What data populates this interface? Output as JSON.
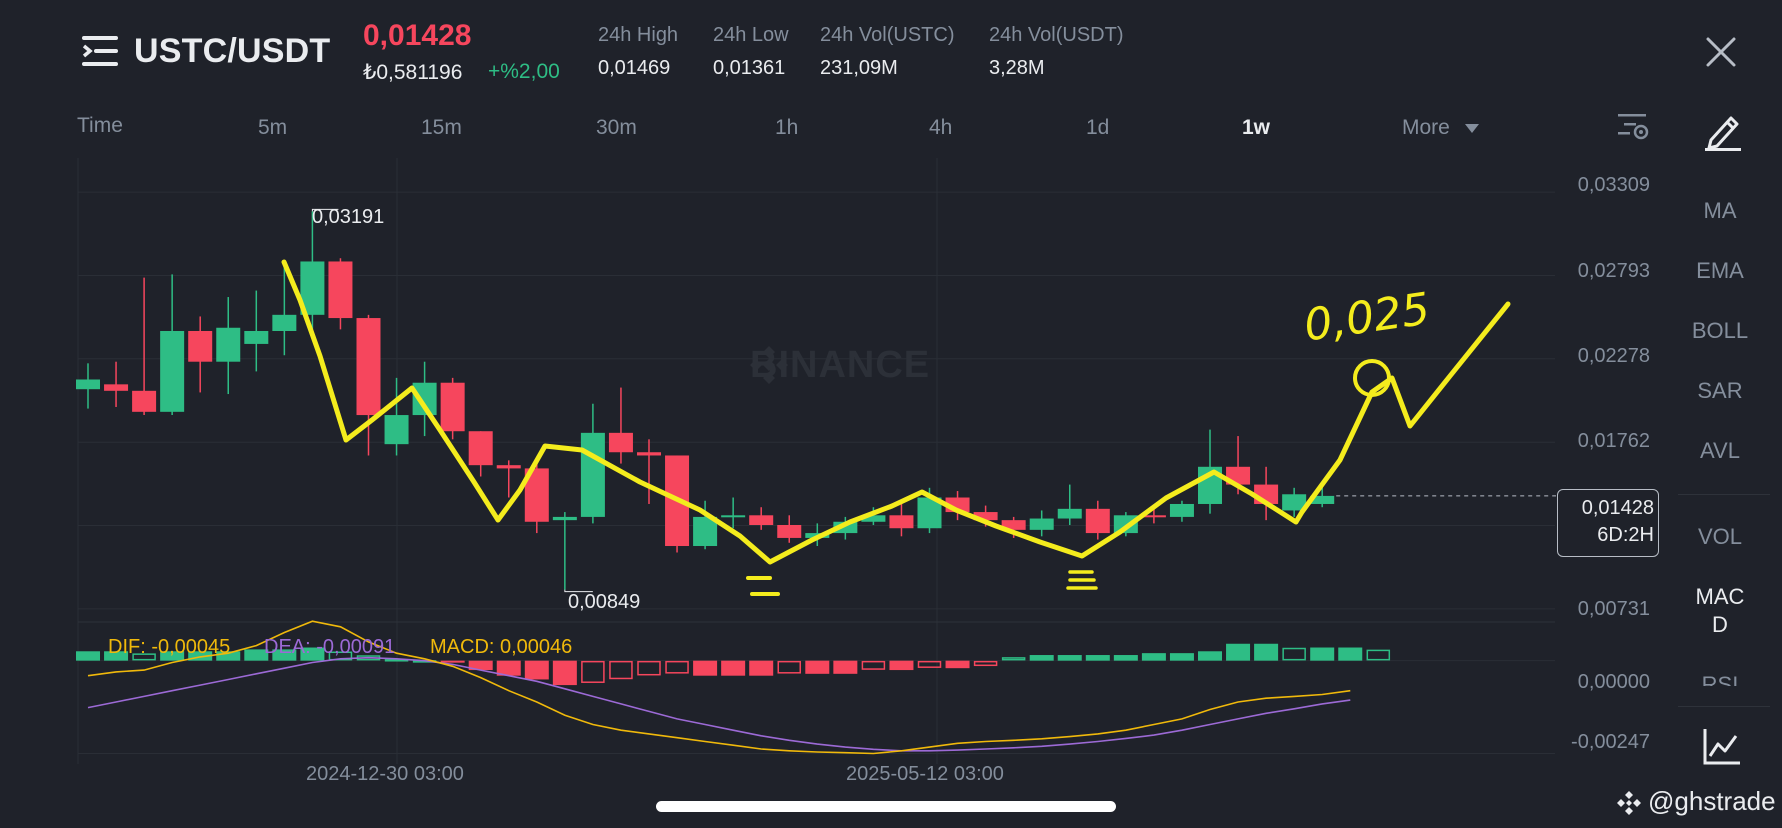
{
  "header": {
    "pair": "USTC/USDT",
    "last_price": "0,01428",
    "fiat_price": "₺0,581196",
    "change": "+%2,00",
    "stats": [
      {
        "label": "24h High",
        "value": "0,01469"
      },
      {
        "label": "24h Low",
        "value": "0,01361"
      },
      {
        "label": "24h Vol(USTC)",
        "value": "231,09M"
      },
      {
        "label": "24h Vol(USDT)",
        "value": "3,28M"
      }
    ]
  },
  "intervals": {
    "time": "Time",
    "m5": "5m",
    "m15": "15m",
    "m30": "30m",
    "h1": "1h",
    "h4": "4h",
    "d1": "1d",
    "w1": "1w",
    "more": "More",
    "active": "1w"
  },
  "indicators": {
    "ma": "MA",
    "ema": "EMA",
    "boll": "BOLL",
    "sar": "SAR",
    "avl": "AVL",
    "vol": "VOL",
    "macd": "MAC\nD",
    "rsi": "RSI"
  },
  "chart": {
    "watermark": "BINANCE",
    "price_ticks": [
      "0,03309",
      "0,02793",
      "0,02278",
      "0,01762",
      "0,00731"
    ],
    "macd_ticks": [
      "0,00000",
      "-0,00247"
    ],
    "time_ticks": [
      "2024-12-30 03:00",
      "2025-05-12 03:00"
    ],
    "current_price_tag": "0,01428",
    "candle_timer": "6D:2H",
    "high_label": "0,03191",
    "low_label": "0,00849",
    "macd_legend": {
      "dif": "DIF: -0,00045",
      "dea": "DEA: -0,00091",
      "macd": "MACD: 0,00046"
    },
    "annotation_text": "0,025",
    "colors": {
      "up": "#2ebd85",
      "down": "#f6465d",
      "dif": "#f0b90b",
      "dea": "#9c6ad6",
      "drawing": "#f4ec1d"
    }
  },
  "chart_data": {
    "type": "candlestick",
    "pair": "USTC/USDT",
    "interval": "1w",
    "ylim": [
      0.0065,
      0.0352
    ],
    "macd_ylim": [
      -0.00275,
      0.00055
    ],
    "candles": [
      {
        "o": 0.0209,
        "h": 0.0225,
        "l": 0.0197,
        "c": 0.0215
      },
      {
        "o": 0.0212,
        "h": 0.0226,
        "l": 0.0198,
        "c": 0.0208
      },
      {
        "o": 0.0208,
        "h": 0.0278,
        "l": 0.0193,
        "c": 0.0195
      },
      {
        "o": 0.0195,
        "h": 0.028,
        "l": 0.0193,
        "c": 0.0245
      },
      {
        "o": 0.0245,
        "h": 0.0254,
        "l": 0.0207,
        "c": 0.0226
      },
      {
        "o": 0.0226,
        "h": 0.0266,
        "l": 0.0206,
        "c": 0.0247
      },
      {
        "o": 0.0237,
        "h": 0.027,
        "l": 0.022,
        "c": 0.0245
      },
      {
        "o": 0.0245,
        "h": 0.0286,
        "l": 0.023,
        "c": 0.0255
      },
      {
        "o": 0.0255,
        "h": 0.0319,
        "l": 0.0245,
        "c": 0.0288
      },
      {
        "o": 0.0288,
        "h": 0.029,
        "l": 0.0246,
        "c": 0.0253
      },
      {
        "o": 0.0253,
        "h": 0.0255,
        "l": 0.0168,
        "c": 0.0193
      },
      {
        "o": 0.0175,
        "h": 0.0216,
        "l": 0.0168,
        "c": 0.0193
      },
      {
        "o": 0.0193,
        "h": 0.0226,
        "l": 0.018,
        "c": 0.0213
      },
      {
        "o": 0.0213,
        "h": 0.0216,
        "l": 0.0178,
        "c": 0.0183
      },
      {
        "o": 0.0183,
        "h": 0.0183,
        "l": 0.0155,
        "c": 0.0162
      },
      {
        "o": 0.0162,
        "h": 0.0165,
        "l": 0.0142,
        "c": 0.016
      },
      {
        "o": 0.016,
        "h": 0.0164,
        "l": 0.012,
        "c": 0.0127
      },
      {
        "o": 0.0128,
        "h": 0.0133,
        "l": 0.0085,
        "c": 0.013
      },
      {
        "o": 0.013,
        "h": 0.02,
        "l": 0.0126,
        "c": 0.0182
      },
      {
        "o": 0.0182,
        "h": 0.021,
        "l": 0.0163,
        "c": 0.017
      },
      {
        "o": 0.017,
        "h": 0.0178,
        "l": 0.0138,
        "c": 0.0168
      },
      {
        "o": 0.0168,
        "h": 0.0168,
        "l": 0.0108,
        "c": 0.0112
      },
      {
        "o": 0.0112,
        "h": 0.014,
        "l": 0.011,
        "c": 0.013
      },
      {
        "o": 0.013,
        "h": 0.0142,
        "l": 0.0123,
        "c": 0.0131
      },
      {
        "o": 0.0131,
        "h": 0.0136,
        "l": 0.0122,
        "c": 0.0125
      },
      {
        "o": 0.0125,
        "h": 0.0131,
        "l": 0.0114,
        "c": 0.0117
      },
      {
        "o": 0.0117,
        "h": 0.0126,
        "l": 0.0112,
        "c": 0.012
      },
      {
        "o": 0.012,
        "h": 0.013,
        "l": 0.0116,
        "c": 0.0127
      },
      {
        "o": 0.0127,
        "h": 0.0136,
        "l": 0.0125,
        "c": 0.0131
      },
      {
        "o": 0.0131,
        "h": 0.014,
        "l": 0.0118,
        "c": 0.0123
      },
      {
        "o": 0.0123,
        "h": 0.0148,
        "l": 0.012,
        "c": 0.0142
      },
      {
        "o": 0.0142,
        "h": 0.0146,
        "l": 0.0128,
        "c": 0.0133
      },
      {
        "o": 0.0133,
        "h": 0.0137,
        "l": 0.0124,
        "c": 0.0128
      },
      {
        "o": 0.0128,
        "h": 0.013,
        "l": 0.0117,
        "c": 0.0122
      },
      {
        "o": 0.0122,
        "h": 0.0134,
        "l": 0.0118,
        "c": 0.0129
      },
      {
        "o": 0.0129,
        "h": 0.015,
        "l": 0.0125,
        "c": 0.0135
      },
      {
        "o": 0.0135,
        "h": 0.014,
        "l": 0.0116,
        "c": 0.012
      },
      {
        "o": 0.012,
        "h": 0.0133,
        "l": 0.0118,
        "c": 0.0131
      },
      {
        "o": 0.0131,
        "h": 0.0135,
        "l": 0.0126,
        "c": 0.013
      },
      {
        "o": 0.013,
        "h": 0.014,
        "l": 0.0127,
        "c": 0.0138
      },
      {
        "o": 0.0138,
        "h": 0.0184,
        "l": 0.0132,
        "c": 0.0161
      },
      {
        "o": 0.0161,
        "h": 0.018,
        "l": 0.0144,
        "c": 0.015
      },
      {
        "o": 0.015,
        "h": 0.0161,
        "l": 0.0128,
        "c": 0.0138
      },
      {
        "o": 0.0134,
        "h": 0.0148,
        "l": 0.013,
        "c": 0.0144
      },
      {
        "o": 0.0138,
        "h": 0.0149,
        "l": 0.0136,
        "c": 0.0143
      }
    ],
    "macd": {
      "hist": [
        0.00025,
        0.00025,
        0.0002,
        0.00025,
        0.00025,
        0.00025,
        0.0003,
        0.0003,
        0.00035,
        0.00025,
        0.00015,
        5e-05,
        2e-05,
        -5e-05,
        -0.00025,
        -0.0004,
        -0.0005,
        -0.00065,
        -0.0006,
        -0.0005,
        -0.0004,
        -0.00035,
        -0.0004,
        -0.0004,
        -0.0004,
        -0.00035,
        -0.00035,
        -0.00035,
        -0.00025,
        -0.00025,
        -0.0002,
        -0.0002,
        -0.00015,
        0.0001,
        0.00015,
        0.00015,
        0.00015,
        0.00015,
        0.0002,
        0.0002,
        0.00025,
        0.00045,
        0.00045,
        0.00035,
        0.00035,
        0.00035,
        0.0003
      ],
      "dif": [
        -0.0004,
        -0.0003,
        -0.00025,
        -5e-05,
        0.0001,
        0.0002,
        0.0004,
        0.00075,
        0.00105,
        0.0009,
        0.0005,
        0.0002,
        5e-05,
        -0.00015,
        -0.00045,
        -0.0008,
        -0.0011,
        -0.00145,
        -0.0017,
        -0.00185,
        -0.00195,
        -0.00205,
        -0.00215,
        -0.00225,
        -0.00235,
        -0.0024,
        -0.00243,
        -0.00245,
        -0.00247,
        -0.0024,
        -0.0023,
        -0.0022,
        -0.00215,
        -0.00212,
        -0.00208,
        -0.00202,
        -0.00195,
        -0.00185,
        -0.0017,
        -0.00155,
        -0.0013,
        -0.0011,
        -0.001,
        -0.00095,
        -0.0009,
        -0.0008
      ],
      "dea": [
        -0.00125,
        -0.0011,
        -0.00095,
        -0.0008,
        -0.00065,
        -0.0005,
        -0.00035,
        -0.0002,
        -5e-05,
        5e-05,
        8e-05,
        5e-05,
        0.0,
        -0.0001,
        -0.00025,
        -0.0004,
        -0.00055,
        -0.00075,
        -0.00095,
        -0.00115,
        -0.00135,
        -0.00155,
        -0.0017,
        -0.00185,
        -0.002,
        -0.00212,
        -0.00222,
        -0.0023,
        -0.00236,
        -0.0024,
        -0.0024,
        -0.00238,
        -0.00235,
        -0.00232,
        -0.00228,
        -0.00222,
        -0.00215,
        -0.00207,
        -0.00198,
        -0.00185,
        -0.0017,
        -0.00155,
        -0.0014,
        -0.00128,
        -0.00115,
        -0.00105
      ]
    }
  }
}
